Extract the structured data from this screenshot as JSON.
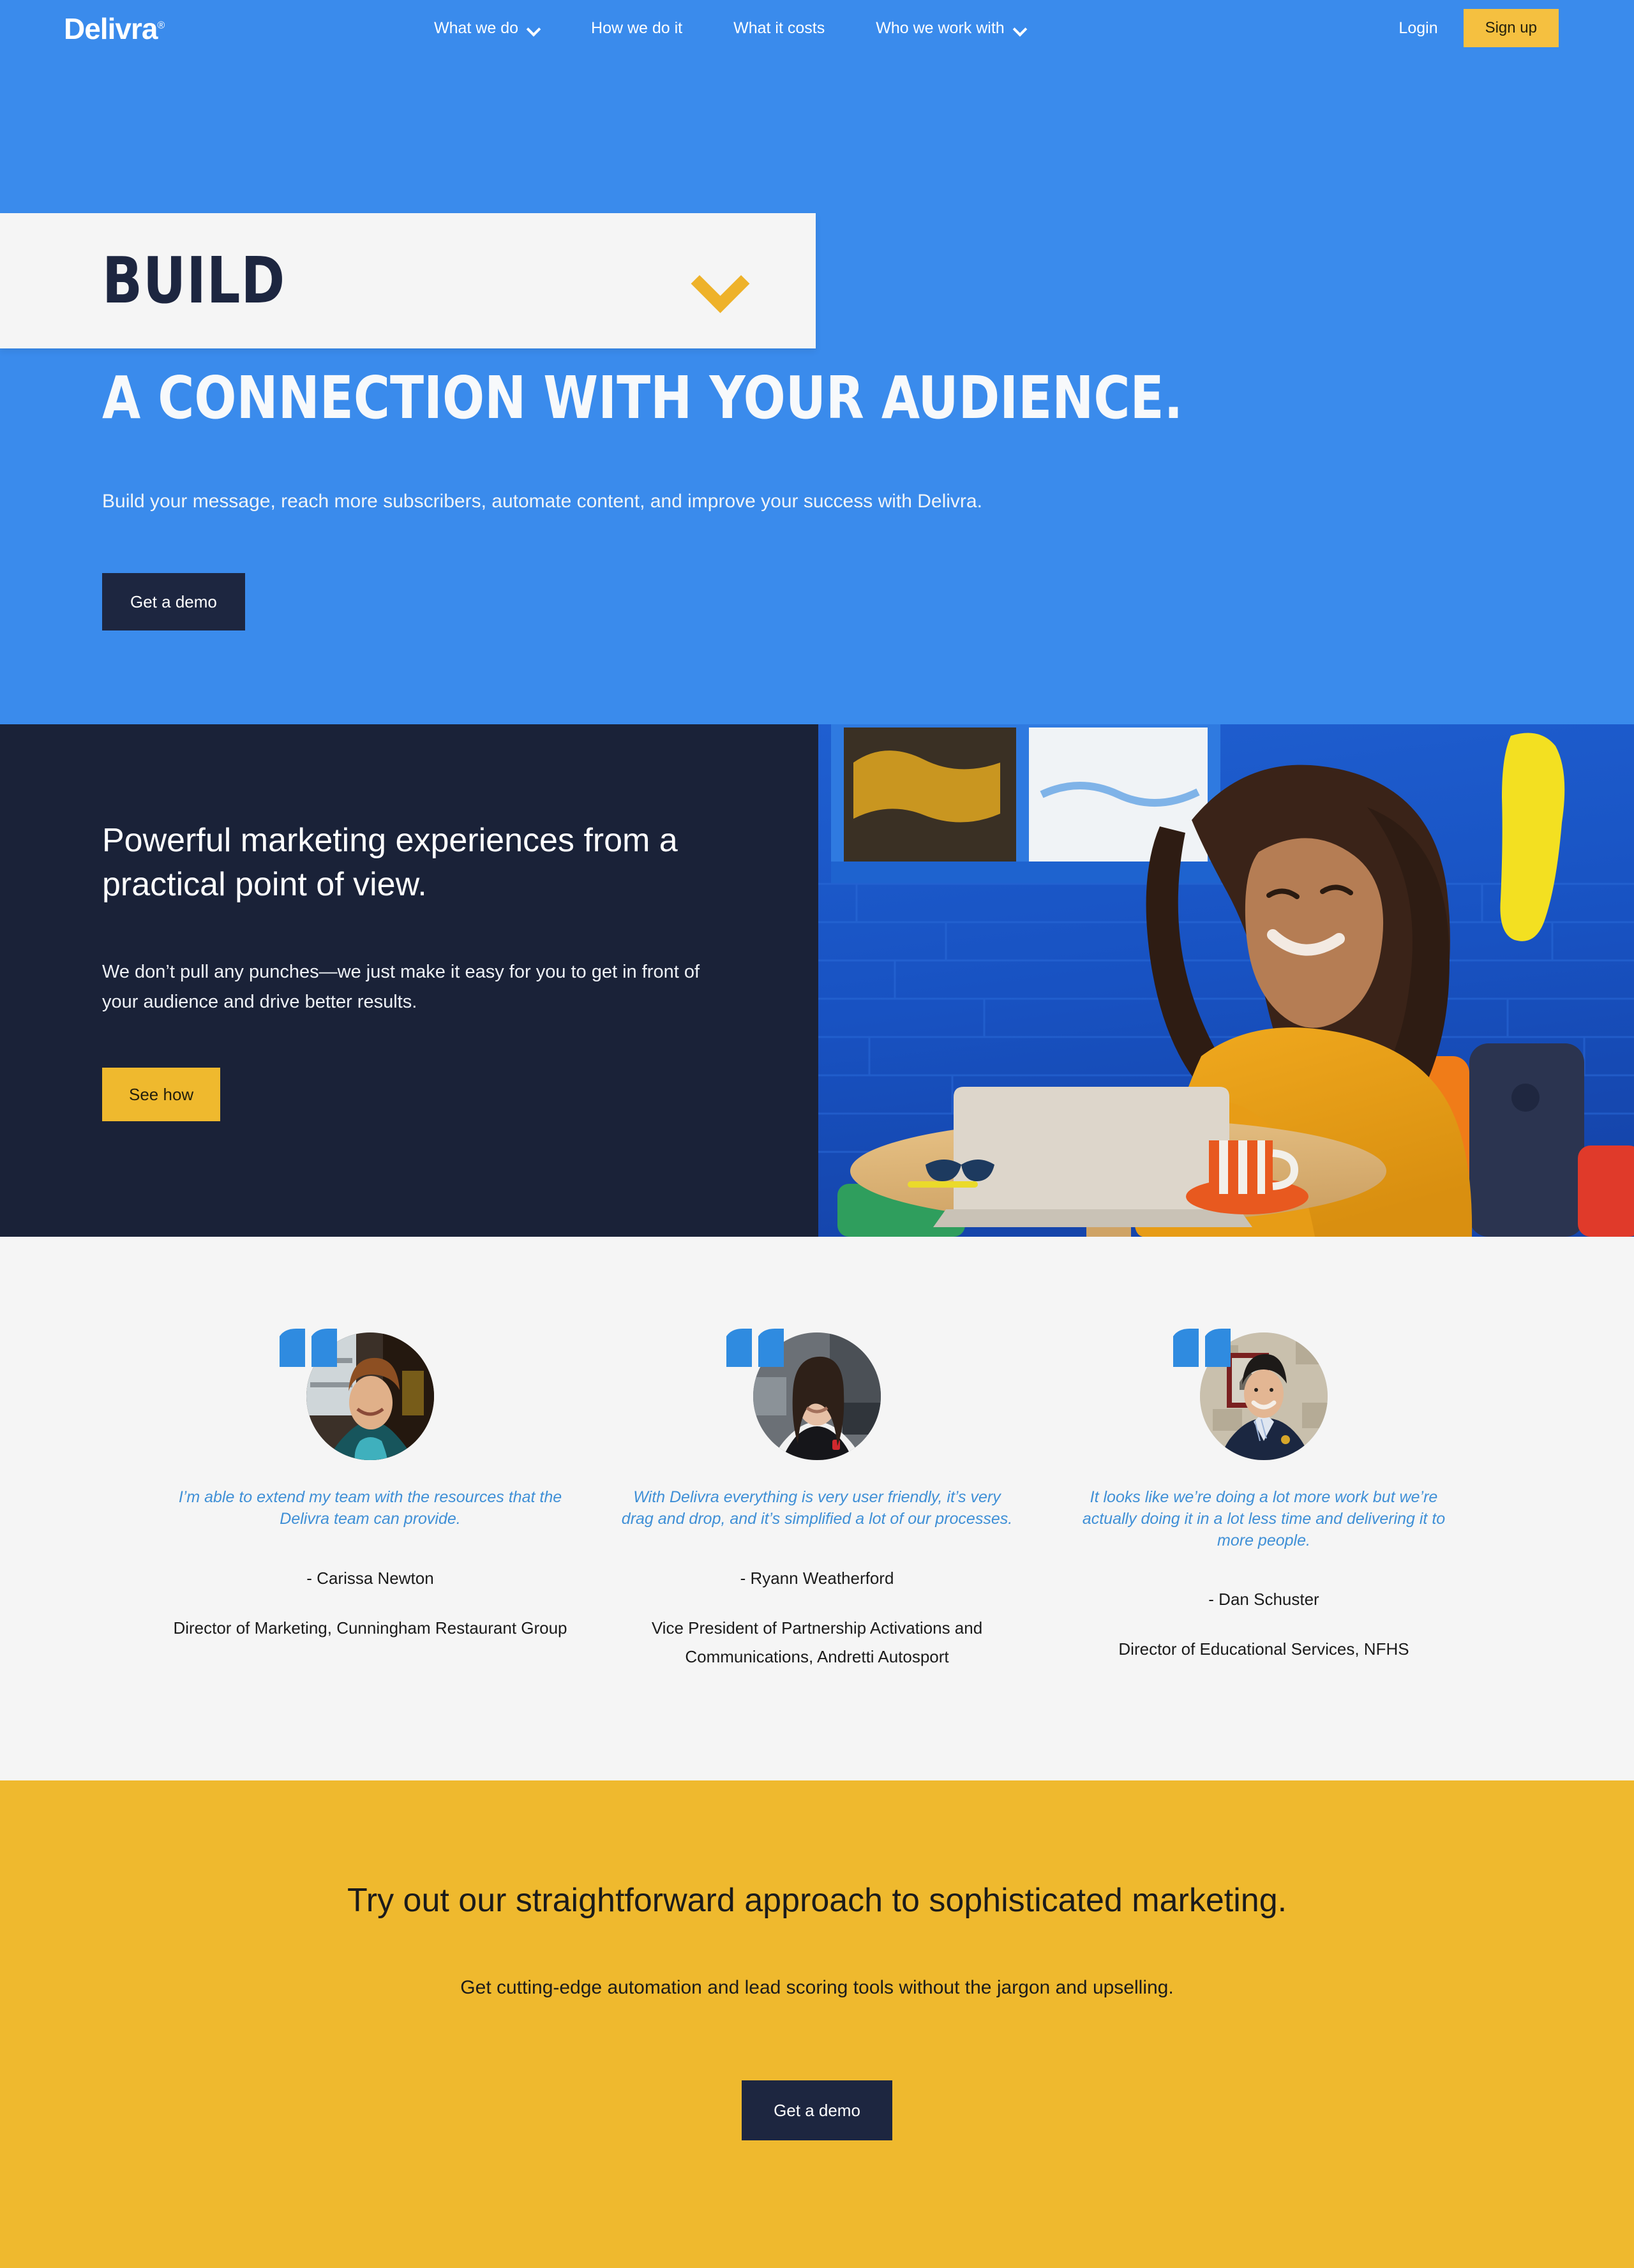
{
  "brand": {
    "name": "Delivra",
    "tm": "®",
    "colors": {
      "blue": "#3a8bec",
      "navy": "#1a2238",
      "yellow": "#efb92e",
      "offwhite": "#f5f5f5",
      "quote_blue": "#3f8fd6"
    }
  },
  "nav": {
    "links": [
      {
        "label": "What we do",
        "has_dropdown": true
      },
      {
        "label": "How we do it",
        "has_dropdown": false
      },
      {
        "label": "What it costs",
        "has_dropdown": false
      },
      {
        "label": "Who we work with",
        "has_dropdown": true
      }
    ],
    "login_label": "Login",
    "signup_label": "Sign up"
  },
  "hero": {
    "panel_word": "BUILD",
    "headline": "A CONNECTION WITH YOUR AUDIENCE.",
    "subhead": "Build your message, reach more subscribers, automate content, and improve your success with Delivra.",
    "cta_label": "Get a demo"
  },
  "feature": {
    "heading": "Powerful marketing experiences from a practical point of view.",
    "body": "We don’t pull any punches—we just make it easy for you to get in front of your audience and drive better results.",
    "cta_label": "See how",
    "photo_alt": "Woman in yellow sweater smiling at a laptop in a cafe with a blue brick wall"
  },
  "testimonials": [
    {
      "quote": "I’m able to extend my team with the resources that the Delivra team can provide.",
      "name": "- Carissa Newton",
      "role": "Director of Marketing, Cunningham Restaurant Group"
    },
    {
      "quote": "With Delivra everything is very user friendly, it’s very drag and drop, and it’s simplified a lot of our processes.",
      "name": "- Ryann Weatherford",
      "role": "Vice President of Partnership Activations and Communications, Andretti Autosport"
    },
    {
      "quote": "It looks like we’re doing a lot more work but we’re actually doing it in a lot less time and delivering it to more people.",
      "name": "- Dan Schuster",
      "role": "Director of Educational Services, NFHS"
    }
  ],
  "cta": {
    "heading": "Try out our straightforward approach to sophisticated marketing.",
    "body": "Get cutting-edge automation and lead scoring tools without the jargon and upselling.",
    "button_label": "Get a demo"
  }
}
